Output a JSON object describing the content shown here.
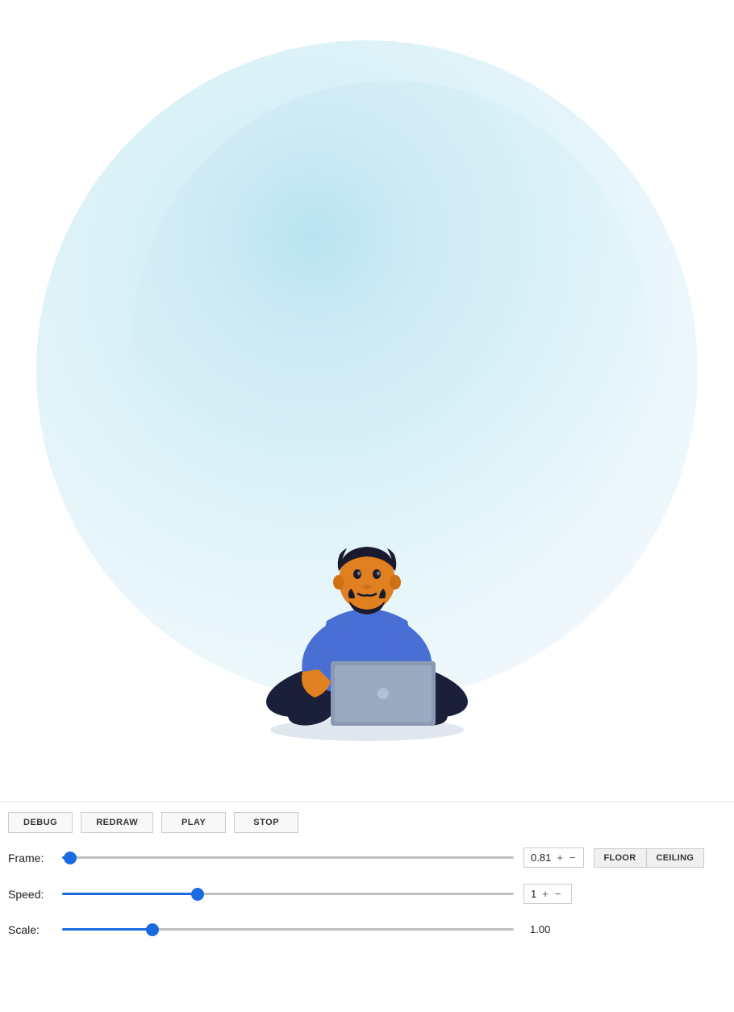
{
  "toolbar": {
    "debug_label": "DEBUG",
    "redraw_label": "REDRAW",
    "play_label": "PLAY",
    "stop_label": "STOP"
  },
  "frame_control": {
    "label": "Frame:",
    "value": "0.81",
    "plus_label": "+",
    "minus_label": "−",
    "thumb_position_pct": 1.8,
    "floor_label": "FLOOR",
    "ceiling_label": "CEILING"
  },
  "speed_control": {
    "label": "Speed:",
    "value": "1",
    "plus_label": "+",
    "minus_label": "−",
    "thumb_position_pct": 30
  },
  "scale_control": {
    "label": "Scale:",
    "value": "1.00",
    "thumb_position_pct": 20
  },
  "colors": {
    "accent_blue": "#1a6be0",
    "bg_white": "#ffffff",
    "track_gray": "#c0c0c0",
    "border_gray": "#cccccc"
  }
}
